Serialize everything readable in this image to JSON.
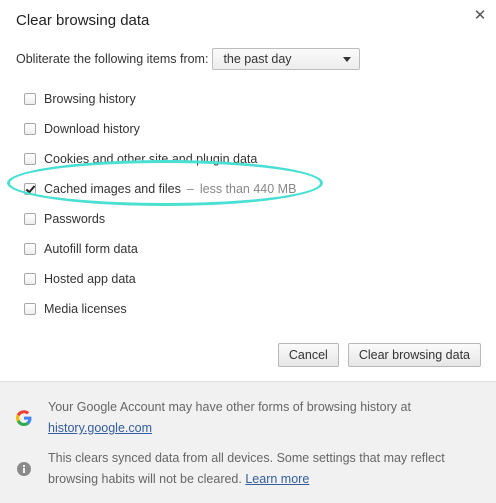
{
  "dialog": {
    "title": "Clear browsing data",
    "close_icon": "close-icon"
  },
  "range": {
    "label": "Obliterate the following items from:",
    "selected": "the past day"
  },
  "options": [
    {
      "label": "Browsing history",
      "checked": false
    },
    {
      "label": "Download history",
      "checked": false
    },
    {
      "label": "Cookies and other site and plugin data",
      "checked": false
    },
    {
      "label": "Cached images and files",
      "checked": true,
      "separator": "–",
      "detail": "less than 440 MB"
    },
    {
      "label": "Passwords",
      "checked": false
    },
    {
      "label": "Autofill form data",
      "checked": false
    },
    {
      "label": "Hosted app data",
      "checked": false
    },
    {
      "label": "Media licenses",
      "checked": false
    }
  ],
  "buttons": {
    "cancel": "Cancel",
    "clear": "Clear browsing data"
  },
  "footer": {
    "google_note": "Your Google Account may have other forms of browsing history at",
    "google_link": "history.google.com",
    "sync_note": "This clears synced data from all devices. Some settings that may reflect browsing habits will not be cleared.",
    "learn_more": "Learn more"
  },
  "colors": {
    "highlight": "#49e0d3",
    "link": "#335d9c"
  }
}
